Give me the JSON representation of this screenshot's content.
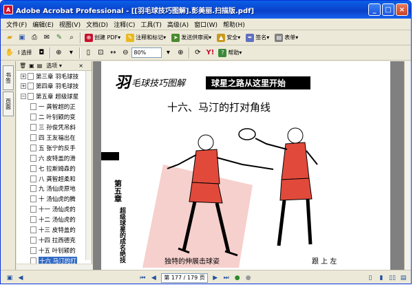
{
  "window": {
    "title": "Adobe Acrobat Professional - [[羽毛球技巧图解].彭美丽.扫描版.pdf]"
  },
  "menu": [
    "文件(F)",
    "编辑(E)",
    "视图(V)",
    "文档(D)",
    "注释(C)",
    "工具(T)",
    "高级(A)",
    "窗口(W)",
    "帮助(H)"
  ],
  "toolbar1": {
    "create_pdf": "创建 PDF",
    "comment": "注释和标记",
    "send_review": "发送供审阅",
    "security": "安全",
    "sign": "签名",
    "forms": "表单"
  },
  "toolbar2": {
    "select": "选择",
    "zoom": "80%",
    "help": "帮助"
  },
  "nav_tabs": [
    "书签",
    "页面"
  ],
  "panel": {
    "options": "选项"
  },
  "bookmarks": [
    {
      "label": "第三章 羽毛球技",
      "kind": "chapter",
      "expand": "+"
    },
    {
      "label": "第四章 羽毛球技",
      "kind": "chapter",
      "expand": "+"
    },
    {
      "label": "第五章 超级球星",
      "kind": "chapter",
      "expand": "−"
    },
    {
      "label": "一 龚智超的正",
      "kind": "item"
    },
    {
      "label": "二 叶钊颖的变",
      "kind": "item"
    },
    {
      "label": "三 孙俊凭吊斜",
      "kind": "item"
    },
    {
      "label": "四 王友福出在",
      "kind": "item"
    },
    {
      "label": "五 张宁的反手",
      "kind": "item"
    },
    {
      "label": "六 皮特盖的滑",
      "kind": "item"
    },
    {
      "label": "七 拉斯姆森的",
      "kind": "item"
    },
    {
      "label": "八 龚智超柔和",
      "kind": "item"
    },
    {
      "label": "九 汤仙虎原地",
      "kind": "item"
    },
    {
      "label": "十 汤仙虎的腾",
      "kind": "item"
    },
    {
      "label": "十一 汤仙虎的",
      "kind": "item"
    },
    {
      "label": "十二 汤仙虎的",
      "kind": "item"
    },
    {
      "label": "十三 皮特盖的",
      "kind": "item"
    },
    {
      "label": "十四 拉西德克",
      "kind": "item"
    },
    {
      "label": "十五 叶钊颖的",
      "kind": "item"
    },
    {
      "label": "十六 马汀的打",
      "kind": "item",
      "selected": true
    }
  ],
  "doc": {
    "header_left": "羽毛球技巧图解",
    "header_right": "球星之路从这里开始",
    "section_title": "十六、马汀的打对角线",
    "chapter_label": "第五章",
    "chapter_sub": "超级球星的成名绝技",
    "caption_left": "独特的伸展击球姿",
    "caption_right": "跟 上 左"
  },
  "status": {
    "page": "第 177 / 179 页"
  },
  "colors": {
    "title_blue": "#0b47d1",
    "accent_red": "#c8102e",
    "selection": "#316ac5"
  }
}
